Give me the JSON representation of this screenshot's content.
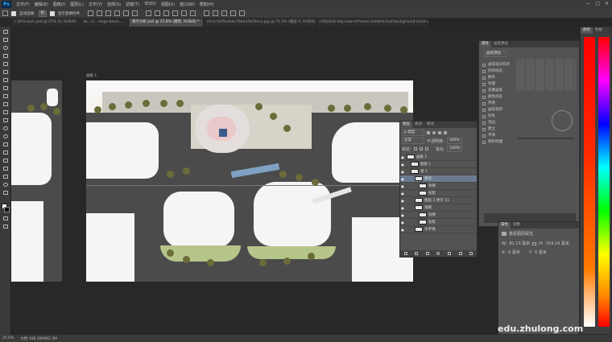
{
  "app": {
    "logo": "Ps",
    "menu": [
      "文件(F)",
      "编辑(E)",
      "图像(I)",
      "图层(L)",
      "文字(Y)",
      "选择(S)",
      "滤镜(T)",
      "3D(D)",
      "视图(V)",
      "窗口(W)",
      "帮助(H)"
    ],
    "window_controls": [
      "—",
      "□",
      "✕"
    ]
  },
  "options": {
    "auto_select_label": "自动选择:",
    "auto_select_value": "组",
    "show_transform_label": "显示变换控件"
  },
  "tabs": [
    {
      "label": "c.jfif-b-ieuh.psd @ 25% (0, RGB/8)",
      "active": false
    },
    {
      "label": "sk...cl...-large-black.....",
      "active": false
    },
    {
      "label": "演示分析.psd @ 25.8% (建筑, RGB/8) *",
      "active": true
    },
    {
      "label": "c4c1c5ef5c4ebc76b4e5b7bcca.jpg @ 71.3% (图层 0, RGB/8) *",
      "active": false
    },
    {
      "label": "c4f2p6dc-big-view-of-home-climbed-leaf-background-stock-photo.jpg",
      "active": false
    }
  ],
  "canvas": {
    "doc_label": "画板 1"
  },
  "layers_panel": {
    "tabs": [
      "图层",
      "通道",
      "路径"
    ],
    "filter_label": "ρ 类型",
    "blend_mode": "正常",
    "opacity_label": "不透明度:",
    "opacity_value": "100%",
    "lock_label": "锁定:",
    "fill_label": "填充:",
    "fill_value": "100%",
    "rows": [
      {
        "name": "画板 1",
        "indent": 0,
        "selected": false
      },
      {
        "name": "图层 1",
        "indent": 1,
        "selected": false
      },
      {
        "name": "组 1",
        "indent": 1,
        "selected": false
      },
      {
        "name": "建筑",
        "indent": 2,
        "selected": true
      },
      {
        "name": "效果",
        "indent": 3,
        "selected": false
      },
      {
        "name": "投影",
        "indent": 3,
        "selected": false
      },
      {
        "name": "图层 3 拷贝 11",
        "indent": 2,
        "selected": false
      },
      {
        "name": "道路",
        "indent": 2,
        "selected": false
      },
      {
        "name": "效果",
        "indent": 3,
        "selected": false
      },
      {
        "name": "投影",
        "indent": 3,
        "selected": false
      },
      {
        "name": "水平线",
        "indent": 2,
        "selected": false
      }
    ]
  },
  "adjust_panel": {
    "tabs": [
      "属性",
      "画笔预设"
    ],
    "preset_button": "画笔预设",
    "rows": [
      "画笔笔尖形状",
      "形状动态",
      "散布",
      "纹理",
      "双重画笔",
      "颜色动态",
      "传递",
      "画笔笔势",
      "杂色",
      "湿边",
      "建立",
      "平滑",
      "保护纹理"
    ]
  },
  "properties_panel": {
    "tabs": [
      "属性",
      "调整"
    ],
    "title": "像素图层属性",
    "w_label": "W:",
    "w_value": "81.13 毫米",
    "h_label": "H:",
    "h_value": "154.14 毫米",
    "x_label": "X:",
    "x_value": "0 毫米",
    "y_label": "Y:",
    "y_value": "0 毫米"
  },
  "color_panel": {
    "tabs": [
      "颜色",
      "色板"
    ]
  },
  "status": {
    "zoom": "25.6%",
    "doc": "文档:106.2M/962.3M"
  },
  "watermark": "edu.zhulong.com",
  "colors": {
    "accent_selected": "#6a7a8f",
    "panel": "#535353",
    "background": "#282828"
  }
}
